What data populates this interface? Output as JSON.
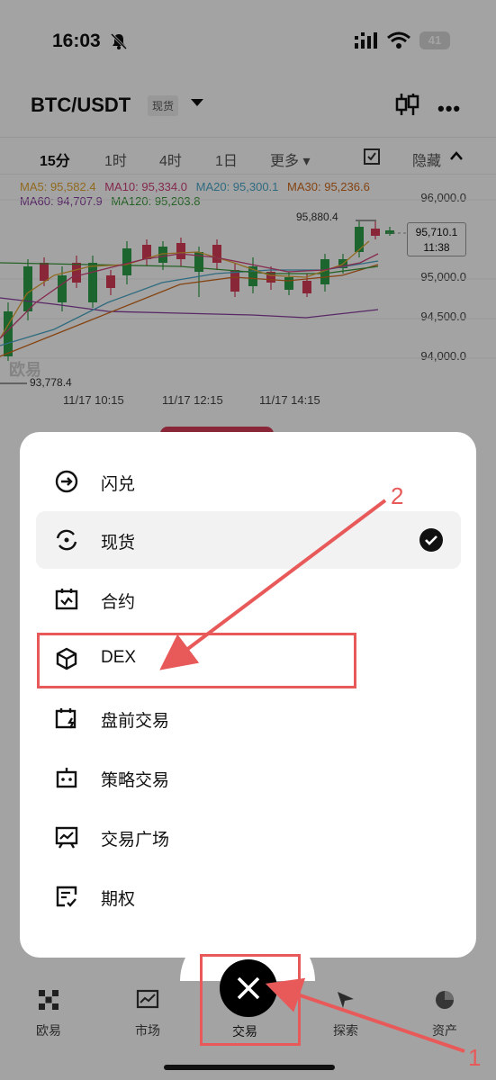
{
  "status_bar": {
    "time": "16:03",
    "battery": "41"
  },
  "header": {
    "pair": "BTC/USDT",
    "market_badge": "现货"
  },
  "timeframes": {
    "m15": "15分",
    "h1": "1时",
    "h4": "4时",
    "d1": "1日",
    "more": "更多 ▾",
    "hide": "隐藏"
  },
  "chart": {
    "ma": {
      "ma5": "MA5: 95,582.4",
      "ma10": "MA10: 95,334.0",
      "ma20": "MA20: 95,300.1",
      "ma30": "MA30: 95,236.6",
      "ma60": "MA60: 94,707.9",
      "ma120": "MA120: 95,203.8"
    },
    "y_ticks": [
      "96,000.0",
      "95,000.0",
      "94,500.0",
      "94,000.0"
    ],
    "high_label": "95,880.4",
    "low_label": "93,778.4",
    "price_tag": "95,710.1",
    "countdown": "11:38",
    "x_ticks": [
      "11/17 10:15",
      "11/17 12:15",
      "11/17 14:15"
    ],
    "watermark": "欧易",
    "colors": {
      "ma5": "#e2a632",
      "ma10": "#d0417a",
      "ma20": "#4aa8c8",
      "ma30": "#d06a1c",
      "ma60": "#8a3fa0",
      "ma120": "#3a9a3a",
      "up": "#2e9e49",
      "down": "#d63d5a"
    }
  },
  "menu": {
    "items": [
      {
        "label": "闪兑",
        "icon": "flash-swap-icon"
      },
      {
        "label": "现货",
        "icon": "spot-icon",
        "selected": true
      },
      {
        "label": "合约",
        "icon": "futures-icon"
      },
      {
        "label": "DEX",
        "icon": "dex-cube-icon"
      },
      {
        "label": "盘前交易",
        "icon": "pre-market-icon"
      },
      {
        "label": "策略交易",
        "icon": "strategy-bot-icon"
      },
      {
        "label": "交易广场",
        "icon": "trading-square-icon"
      },
      {
        "label": "期权",
        "icon": "options-icon"
      }
    ]
  },
  "bottom_nav": {
    "home": "欧易",
    "market": "市场",
    "trade": "交易",
    "discover": "探索",
    "assets": "资产"
  },
  "annotations": {
    "n1": "1",
    "n2": "2",
    "color": "#e85a5a"
  }
}
